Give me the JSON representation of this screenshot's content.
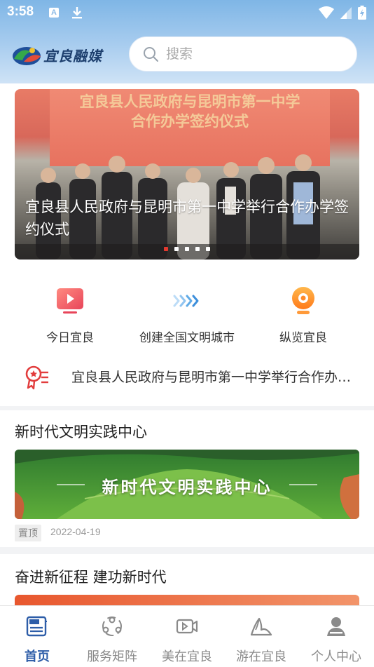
{
  "status_bar": {
    "time": "3:58",
    "a_label": "A"
  },
  "header": {
    "logo_text": "宜良融媒",
    "search_placeholder": "搜索"
  },
  "banner": {
    "sign_line1": "宜良县人民政府与昆明市第一中学",
    "sign_line2": "合作办学签约仪式",
    "caption": "宜良县人民政府与昆明市第一中学举行合作办学签约仪式",
    "dot_count": 5,
    "active_dot": 1
  },
  "quick_entries": [
    {
      "label": "今日宜良",
      "icon": "tv-icon"
    },
    {
      "label": "创建全国文明城市",
      "icon": "arrows-icon"
    },
    {
      "label": "纵览宜良",
      "icon": "camera-icon"
    }
  ],
  "notice": {
    "text": "宜良县人民政府与昆明市第一中学举行合作办学签约仪式",
    "icon": "award-icon"
  },
  "sections": [
    {
      "title": "新时代文明实践中心",
      "image_text": "新时代文明实践中心",
      "tag": "置顶",
      "date": "2022-04-19"
    },
    {
      "title": "奋进新征程 建功新时代"
    }
  ],
  "bottom_nav": [
    {
      "label": "首页",
      "icon": "news-icon",
      "active": true
    },
    {
      "label": "服务矩阵",
      "icon": "people-icon",
      "active": false
    },
    {
      "label": "美在宜良",
      "icon": "video-icon",
      "active": false
    },
    {
      "label": "游在宜良",
      "icon": "mountain-icon",
      "active": false
    },
    {
      "label": "个人中心",
      "icon": "user-icon",
      "active": false
    }
  ],
  "colors": {
    "accent": "#2d5da8",
    "banner_red": "#e4392f",
    "header_blue": "#7fb6e6"
  }
}
